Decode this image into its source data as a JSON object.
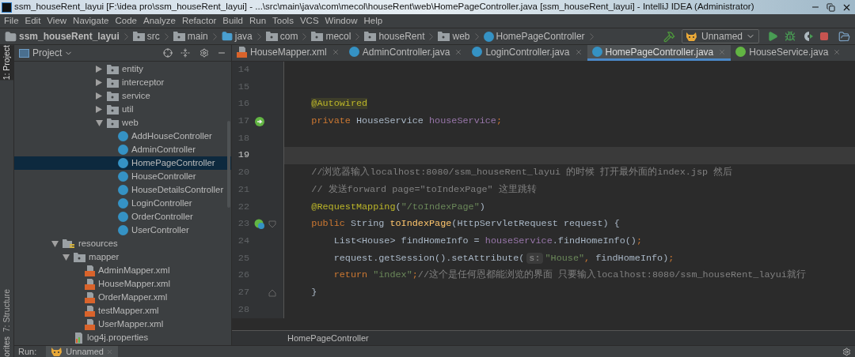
{
  "window": {
    "title": "ssm_houseRent_layui [F:\\idea pro\\ssm_houseRent_layui] - ...\\src\\main\\java\\com\\mecol\\houseRent\\web\\HomePageController.java [ssm_houseRent_layui] - IntelliJ IDEA (Administrator)"
  },
  "menu": [
    "File",
    "Edit",
    "View",
    "Navigate",
    "Code",
    "Analyze",
    "Refactor",
    "Build",
    "Run",
    "Tools",
    "VCS",
    "Window",
    "Help"
  ],
  "breadcrumb": [
    {
      "label": "ssm_houseRent_layui",
      "kind": "project"
    },
    {
      "label": "src",
      "kind": "folder"
    },
    {
      "label": "main",
      "kind": "folder"
    },
    {
      "label": "java",
      "kind": "source"
    },
    {
      "label": "com",
      "kind": "package"
    },
    {
      "label": "mecol",
      "kind": "package"
    },
    {
      "label": "houseRent",
      "kind": "package"
    },
    {
      "label": "web",
      "kind": "package"
    },
    {
      "label": "HomePageController",
      "kind": "class"
    }
  ],
  "run_config": {
    "label": "Unnamed"
  },
  "left_stripe": [
    {
      "label": "1: Project",
      "selected": true
    },
    {
      "label": "7: Structure",
      "selected": false
    }
  ],
  "left_stripe_bottom": "orites",
  "project_panel": {
    "title": "Project"
  },
  "tree": [
    {
      "children": [
        {
          "children": [
            {
              "children": [
                {
                  "children": [
                    {
                      "label": "entity",
                      "kind": "package",
                      "expanded": false,
                      "selected": false
                    },
                    {
                      "label": "interceptor",
                      "kind": "package",
                      "expanded": false,
                      "selected": false
                    },
                    {
                      "label": "service",
                      "kind": "package",
                      "expanded": false,
                      "selected": false
                    },
                    {
                      "label": "util",
                      "kind": "package",
                      "expanded": false,
                      "selected": false
                    },
                    {
                      "label": "web",
                      "kind": "package",
                      "expanded": true,
                      "selected": false,
                      "children": [
                        {
                          "label": "AddHouseController",
                          "kind": "class",
                          "selected": false
                        },
                        {
                          "label": "AdminController",
                          "kind": "class",
                          "selected": false
                        },
                        {
                          "label": "HomePageController",
                          "kind": "class",
                          "selected": true
                        },
                        {
                          "label": "HouseController",
                          "kind": "class",
                          "selected": false
                        },
                        {
                          "label": "HouseDetailsController",
                          "kind": "class",
                          "selected": false
                        },
                        {
                          "label": "LoginController",
                          "kind": "class",
                          "selected": false
                        },
                        {
                          "label": "OrderController",
                          "kind": "class",
                          "selected": false
                        },
                        {
                          "label": "UserController",
                          "kind": "class",
                          "selected": false
                        }
                      ]
                    }
                  ]
                }
              ]
            }
          ]
        }
      ]
    },
    {
      "label": "resources",
      "kind": "resources",
      "expanded": true,
      "selected": false,
      "children": [
        {
          "label": "mapper",
          "kind": "package",
          "expanded": true,
          "selected": false,
          "children": [
            {
              "label": "AdminMapper.xml",
              "kind": "xml",
              "selected": false
            },
            {
              "label": "HouseMapper.xml",
              "kind": "xml",
              "selected": false
            },
            {
              "label": "OrderMapper.xml",
              "kind": "xml",
              "selected": false
            },
            {
              "label": "testMapper.xml",
              "kind": "xml",
              "selected": false
            },
            {
              "label": "UserMapper.xml",
              "kind": "xml",
              "selected": false
            }
          ]
        },
        {
          "label": "log4j.properties",
          "kind": "properties",
          "selected": false
        }
      ]
    }
  ],
  "editor_tabs": [
    {
      "label": "HouseMapper.xml",
      "kind": "xml",
      "selected": false
    },
    {
      "label": "AdminController.java",
      "kind": "class",
      "selected": false
    },
    {
      "label": "LoginController.java",
      "kind": "class",
      "selected": false
    },
    {
      "label": "HomePageController.java",
      "kind": "class",
      "selected": true
    },
    {
      "label": "HouseService.java",
      "kind": "interface",
      "selected": false
    }
  ],
  "code": [
    {
      "number": "14",
      "current": false,
      "kind": "plain"
    },
    {
      "number": "15",
      "current": false,
      "kind": "plain"
    },
    {
      "number": "16",
      "current": false,
      "kind": "plain",
      "tokens": [
        {
          "kind": "annotation_hl",
          "text": "    @Autowired"
        }
      ]
    },
    {
      "number": "17",
      "current": false,
      "kind": "bean",
      "tokens": [
        {
          "kind": "keyword",
          "text": "    private "
        },
        {
          "kind": "plain",
          "text": "HouseService "
        },
        {
          "kind": "field",
          "text": "houseService"
        },
        {
          "kind": "keyword",
          "text": ";"
        }
      ]
    },
    {
      "number": "18",
      "current": false,
      "kind": "plain"
    },
    {
      "number": "19",
      "current": true,
      "kind": "plain"
    },
    {
      "number": "20",
      "current": false,
      "kind": "plain",
      "tokens": [
        {
          "kind": "comment",
          "text": "    //浏览器输入localhost:8080/ssm_houseRent_layui 的时候 打开最外面的index.jsp 然后"
        }
      ]
    },
    {
      "number": "21",
      "current": false,
      "kind": "plain",
      "tokens": [
        {
          "kind": "comment",
          "text": "    // 发送forward page=\"toIndexPage\" 这里跳转"
        }
      ]
    },
    {
      "number": "22",
      "current": false,
      "kind": "plain",
      "tokens": [
        {
          "kind": "annotation",
          "text": "    @RequestMapping"
        },
        {
          "kind": "plain",
          "text": "("
        },
        {
          "kind": "string",
          "text": "\"/toIndexPage\""
        },
        {
          "kind": "plain",
          "text": ")"
        }
      ]
    },
    {
      "number": "23",
      "current": false,
      "kind": "method_start",
      "tokens": [
        {
          "kind": "keyword",
          "text": "    public "
        },
        {
          "kind": "plain",
          "text": "String "
        },
        {
          "kind": "method",
          "text": "toIndexPage"
        },
        {
          "kind": "plain",
          "text": "(HttpServletRequest request) {"
        }
      ]
    },
    {
      "number": "24",
      "current": false,
      "kind": "plain",
      "tokens": [
        {
          "kind": "plain",
          "text": "        List<House> findHomeInfo = "
        },
        {
          "kind": "field",
          "text": "houseService"
        },
        {
          "kind": "plain",
          "text": ".findHomeInfo()"
        },
        {
          "kind": "keyword",
          "text": ";"
        }
      ]
    },
    {
      "number": "25",
      "current": false,
      "kind": "plain",
      "tokens": [
        {
          "kind": "plain",
          "text": "        request.getSession().setAttribute("
        },
        {
          "kind": "hint",
          "text": "s:"
        },
        {
          "kind": "string",
          "text": "\"House\""
        },
        {
          "kind": "keyword",
          "text": ", "
        },
        {
          "kind": "plain",
          "text": "findHomeInfo)"
        },
        {
          "kind": "keyword",
          "text": ";"
        }
      ]
    },
    {
      "number": "26",
      "current": false,
      "kind": "plain",
      "tokens": [
        {
          "kind": "keyword",
          "text": "        return "
        },
        {
          "kind": "string",
          "text": "\"index\""
        },
        {
          "kind": "keyword",
          "text": ";"
        },
        {
          "kind": "comment",
          "text": "//这个是任何恩都能浏览的界面 只要输入localhost:8080/ssm_houseRent_layui就行"
        }
      ]
    },
    {
      "number": "27",
      "current": false,
      "kind": "method_end",
      "tokens": [
        {
          "kind": "plain",
          "text": "    }"
        }
      ]
    },
    {
      "number": "28",
      "current": false,
      "kind": "plain"
    }
  ],
  "editor_breadcrumb": "HomePageController",
  "run_bar": {
    "label": "Run:",
    "tab": "Unnamed"
  }
}
